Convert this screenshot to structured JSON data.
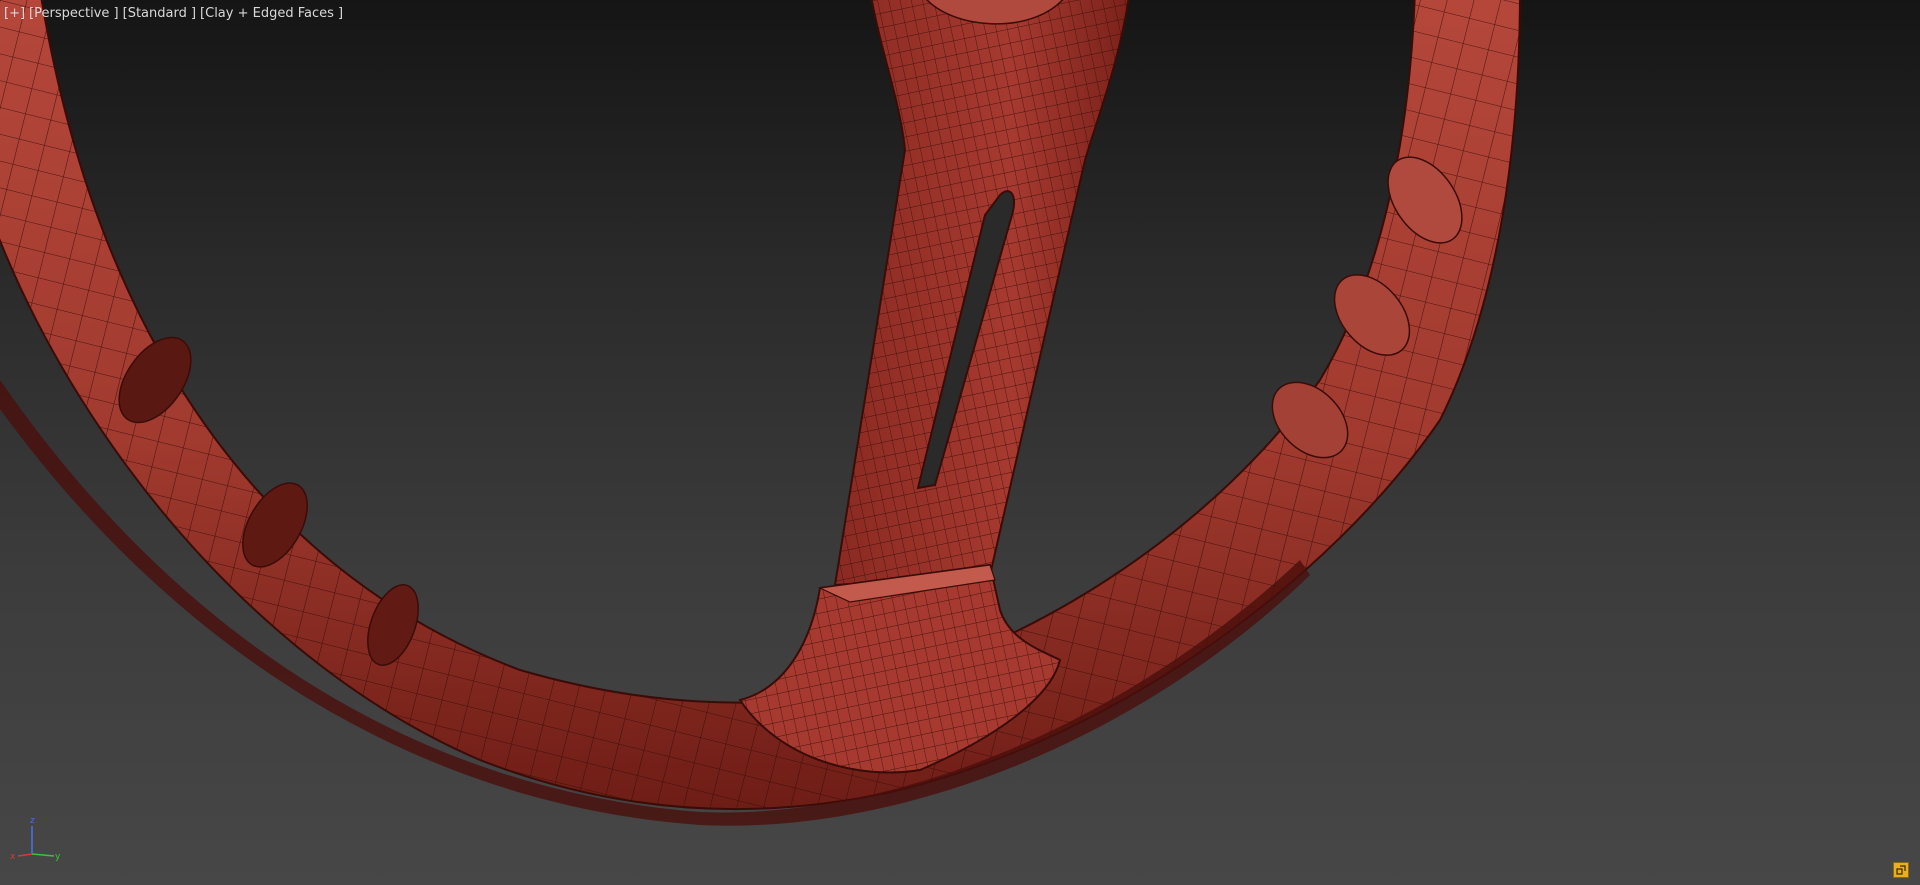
{
  "viewport": {
    "label_plus": "[+]",
    "label_view": "[Perspective ]",
    "label_shading_preset": "[Standard ]",
    "label_shading_mode": "[Clay + Edged Faces ]"
  },
  "axis": {
    "z": "z",
    "x": "x",
    "y": "y",
    "colors": {
      "x": "#d43a3a",
      "y": "#3ac43a",
      "z": "#4a6ee0"
    }
  },
  "model": {
    "clay_color": "#a63a30",
    "edge_color": "#3a0c08"
  },
  "corner_button": {
    "icon": "maximize-toggle-icon"
  }
}
